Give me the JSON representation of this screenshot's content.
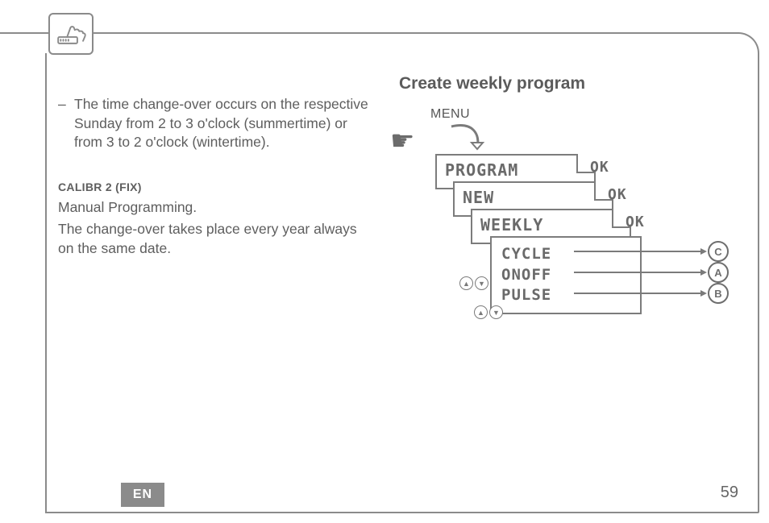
{
  "left": {
    "bullet_dash": "–",
    "bullet_text": "The time change-over occurs on the respective Sunday from 2 to 3 o'clock (summertime) or from 3 to 2 o'clock (wintertime).",
    "section_title": "CALIBR 2 (FIX)",
    "section_body_1": "Manual Programming.",
    "section_body_2": "The change-over takes place every year always on the same date."
  },
  "right": {
    "heading": "Create weekly program",
    "menu_label": "MENU",
    "ok": "OK",
    "cards": {
      "program": "PROGRAM",
      "new": "NEW",
      "weekly": "WEEKLY"
    },
    "options": {
      "cycle": "CYCLE",
      "onoff": "ONOFF",
      "pulse": "PULSE"
    },
    "refs": {
      "a": "A",
      "b": "B",
      "c": "C"
    }
  },
  "footer": {
    "lang": "EN",
    "page": "59"
  }
}
